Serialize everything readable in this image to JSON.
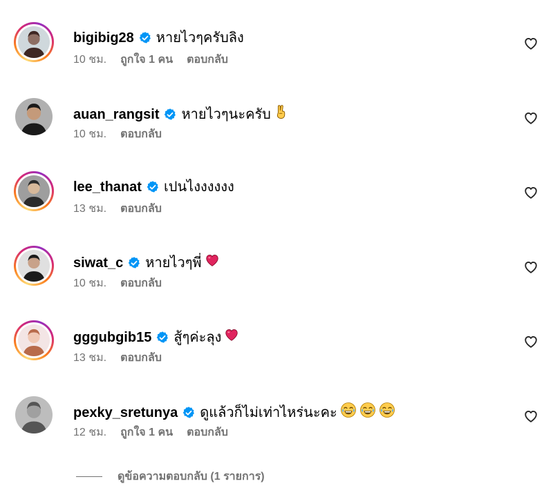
{
  "colors": {
    "text": "#000000",
    "secondary": "#737373",
    "verified": "#0095f6"
  },
  "comments": [
    {
      "username": "bigibig28",
      "verified": true,
      "text": "หายไวๆครับลิง",
      "emojis": [],
      "time": "10 ชม.",
      "likes": "ถูกใจ 1 คน",
      "reply": "ตอบกลับ",
      "avatar_ring": true,
      "avatar_icon": "user-avatar-icon"
    },
    {
      "username": "auan_rangsit",
      "verified": true,
      "text": "หายไวๆนะครับ",
      "emojis": [
        "victory-hand-emoji"
      ],
      "time": "10 ชม.",
      "likes": "",
      "reply": "ตอบกลับ",
      "avatar_ring": false,
      "avatar_icon": "user-avatar-icon"
    },
    {
      "username": "lee_thanat",
      "verified": true,
      "text": "เปนไงงงงงง",
      "emojis": [],
      "time": "13 ชม.",
      "likes": "",
      "reply": "ตอบกลับ",
      "avatar_ring": true,
      "avatar_icon": "user-avatar-icon"
    },
    {
      "username": "siwat_c",
      "verified": true,
      "text": "หายไวๆพี่",
      "emojis": [
        "red-heart-emoji"
      ],
      "time": "10 ชม.",
      "likes": "",
      "reply": "ตอบกลับ",
      "avatar_ring": true,
      "avatar_icon": "user-avatar-icon"
    },
    {
      "username": "gggubgib15",
      "verified": true,
      "text": "สู้ๆค่ะลุง",
      "emojis": [
        "red-heart-emoji"
      ],
      "time": "13 ชม.",
      "likes": "",
      "reply": "ตอบกลับ",
      "avatar_ring": true,
      "avatar_icon": "user-avatar-icon"
    },
    {
      "username": "pexky_sretunya",
      "verified": true,
      "text": "ดูแล้วก็ไม่เท่าไหร่นะคะ",
      "emojis": [
        "joy-emoji",
        "joy-emoji",
        "joy-emoji"
      ],
      "time": "12 ชม.",
      "likes": "ถูกใจ 1 คน",
      "reply": "ตอบกลับ",
      "avatar_ring": false,
      "avatar_icon": "user-avatar-icon"
    }
  ],
  "view_replies": "ดูข้อความตอบกลับ (1 รายการ)"
}
